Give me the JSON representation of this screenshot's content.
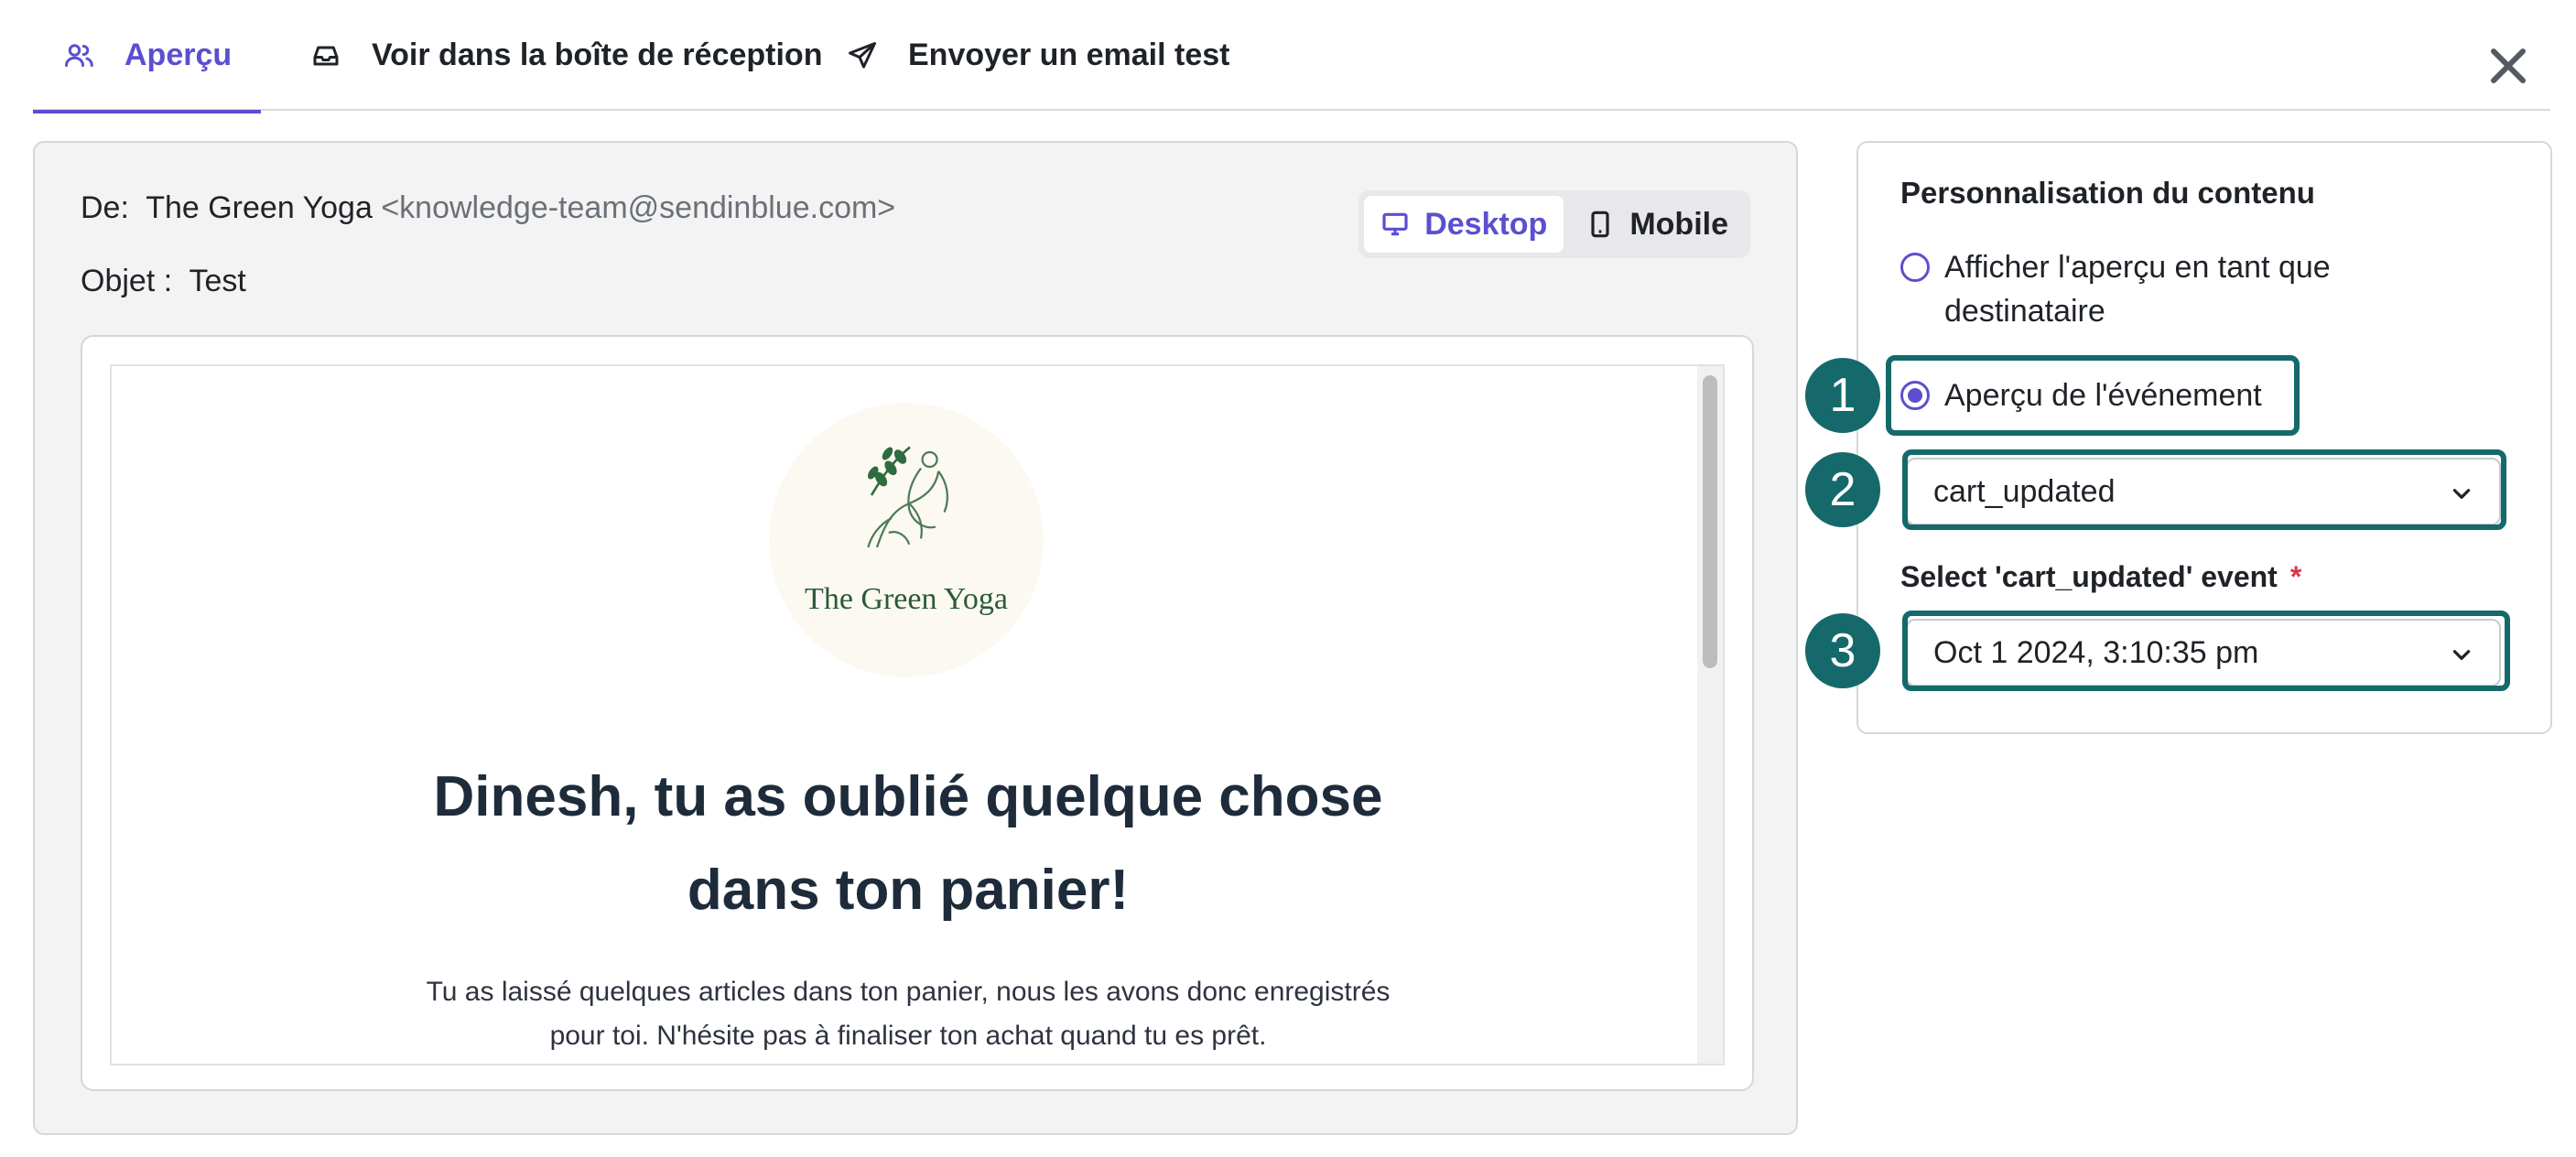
{
  "tabs": [
    {
      "label": "Aperçu",
      "icon": "users-icon",
      "active": true
    },
    {
      "label": "Voir dans la boîte de réception",
      "icon": "inbox-icon",
      "active": false
    },
    {
      "label": "Envoyer un email test",
      "icon": "send-icon",
      "active": false
    }
  ],
  "close_icon": "close-icon",
  "email_meta": {
    "from_label": "De:",
    "from_name": "The Green Yoga",
    "from_address": "<knowledge-team@sendinblue.com>",
    "subject_label": "Objet :",
    "subject_value": "Test"
  },
  "device_toggle": {
    "desktop_label": "Desktop",
    "mobile_label": "Mobile",
    "selected": "Desktop"
  },
  "email_preview": {
    "logo_text": "The Green Yoga",
    "headline_line1": "Dinesh, tu as oublié quelque chose",
    "headline_line2": "dans ton panier!",
    "body_line1": "Tu as laissé quelques articles dans ton panier, nous les avons donc enregistrés",
    "body_line2": "pour toi. N'hésite pas à finaliser ton achat quand tu es prêt."
  },
  "personalisation": {
    "title": "Personnalisation du contenu",
    "option1_line1": "Afficher l'aperçu en tant que",
    "option1_line2": "destinataire",
    "option2": "Aperçu de l'événement",
    "selected_option": "Aperçu de l'événement",
    "event_select_value": "cart_updated",
    "event_field_label": "Select 'cart_updated' event",
    "required_mark": "*",
    "event_date_value": "Oct 1 2024, 3:10:35 pm"
  },
  "annotations": [
    "1",
    "2",
    "3"
  ],
  "colors": {
    "accent": "#5b4fcf",
    "annotation": "#15696a",
    "required": "#e0344a"
  }
}
